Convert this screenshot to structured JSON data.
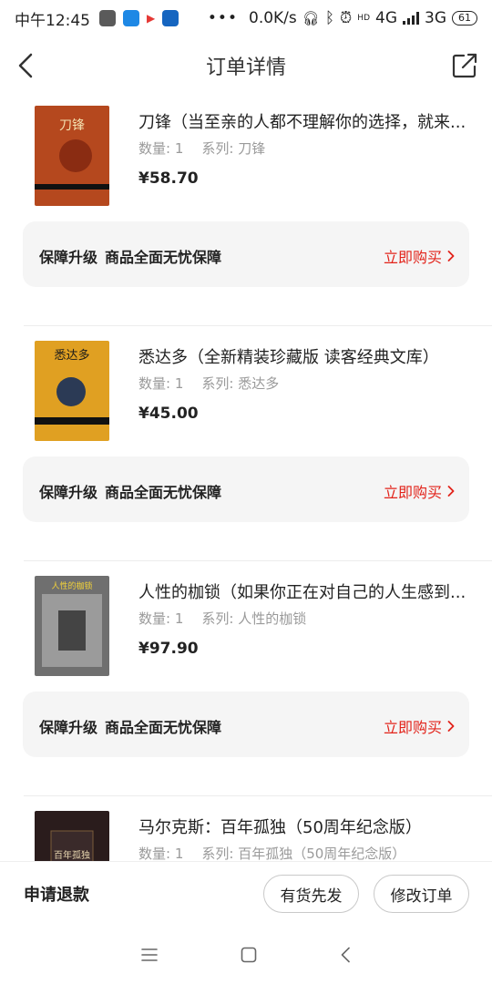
{
  "status_bar": {
    "time": "中午12:45",
    "network_speed": "0.0K/s",
    "hd_label": "HD",
    "net1": "4G",
    "net2": "3G",
    "battery": "61"
  },
  "header": {
    "title": "订单详情"
  },
  "items": [
    {
      "title": "刀锋（当至亲的人都不理解你的选择，就来...",
      "qty_label": "数量: 1",
      "series_label": "系列: 刀锋",
      "price": "¥58.70",
      "cover_title": "刀锋",
      "cover_color": "#b5481e"
    },
    {
      "title": "悉达多（全新精装珍藏版 读客经典文库）",
      "qty_label": "数量: 1",
      "series_label": "系列: 悉达多",
      "price": "¥45.00",
      "cover_title": "悉达多",
      "cover_color": "#e0a022"
    },
    {
      "title": "人性的枷锁（如果你正在对自己的人生感到...",
      "qty_label": "数量: 1",
      "series_label": "系列: 人性的枷锁",
      "price": "¥97.90",
      "cover_title": "人性的枷锁",
      "cover_color": "#6f6f6f"
    },
    {
      "title": "马尔克斯：百年孤独（50周年纪念版）",
      "qty_label": "数量: 1",
      "series_label": "系列: 百年孤独（50周年纪念版）",
      "price": "",
      "cover_title": "百年孤独",
      "cover_color": "#2a1c1c"
    }
  ],
  "warranty": {
    "label": "保障升级",
    "desc": "商品全面无忧保障",
    "buy": "立即购买"
  },
  "bottom_bar": {
    "refund": "申请退款",
    "stock_first": "有货先发",
    "modify": "修改订单"
  }
}
